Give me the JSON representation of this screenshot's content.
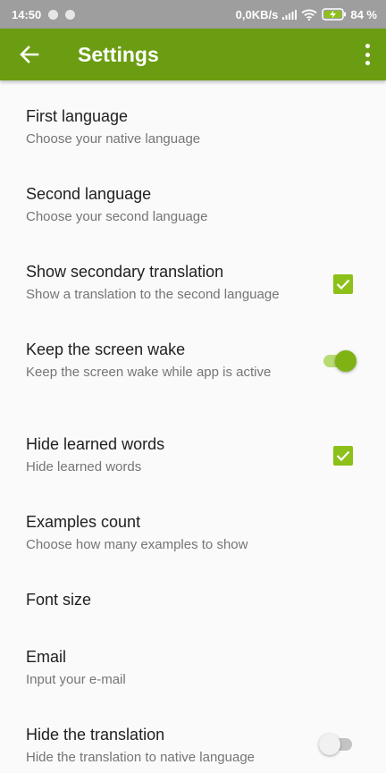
{
  "status_bar": {
    "time": "14:50",
    "network_speed": "0,0KB/s",
    "battery_percent": "84 %"
  },
  "app_bar": {
    "title": "Settings"
  },
  "settings": [
    {
      "title": "First language",
      "subtitle": "Choose your native language"
    },
    {
      "title": "Second language",
      "subtitle": "Choose your second language"
    },
    {
      "title": "Show secondary translation",
      "subtitle": "Show a translation to the second language",
      "control": "checkbox",
      "checked": true
    },
    {
      "title": "Keep the screen wake",
      "subtitle": "Keep the screen wake while app is active",
      "control": "switch",
      "on": true
    },
    {
      "title": "Hide learned words",
      "subtitle": "Hide learned words",
      "control": "checkbox",
      "checked": true
    },
    {
      "title": "Examples count",
      "subtitle": "Choose how many examples to show"
    },
    {
      "title": "Font size"
    },
    {
      "title": "Email",
      "subtitle": "Input your e-mail"
    },
    {
      "title": "Hide the translation",
      "subtitle": "Hide the translation to native language",
      "control": "switch",
      "on": false
    }
  ],
  "colors": {
    "status_bar": "#9e9e9e",
    "app_bar": "#6b9d12",
    "accent": "#8ec01a",
    "background": "#fafafa"
  }
}
